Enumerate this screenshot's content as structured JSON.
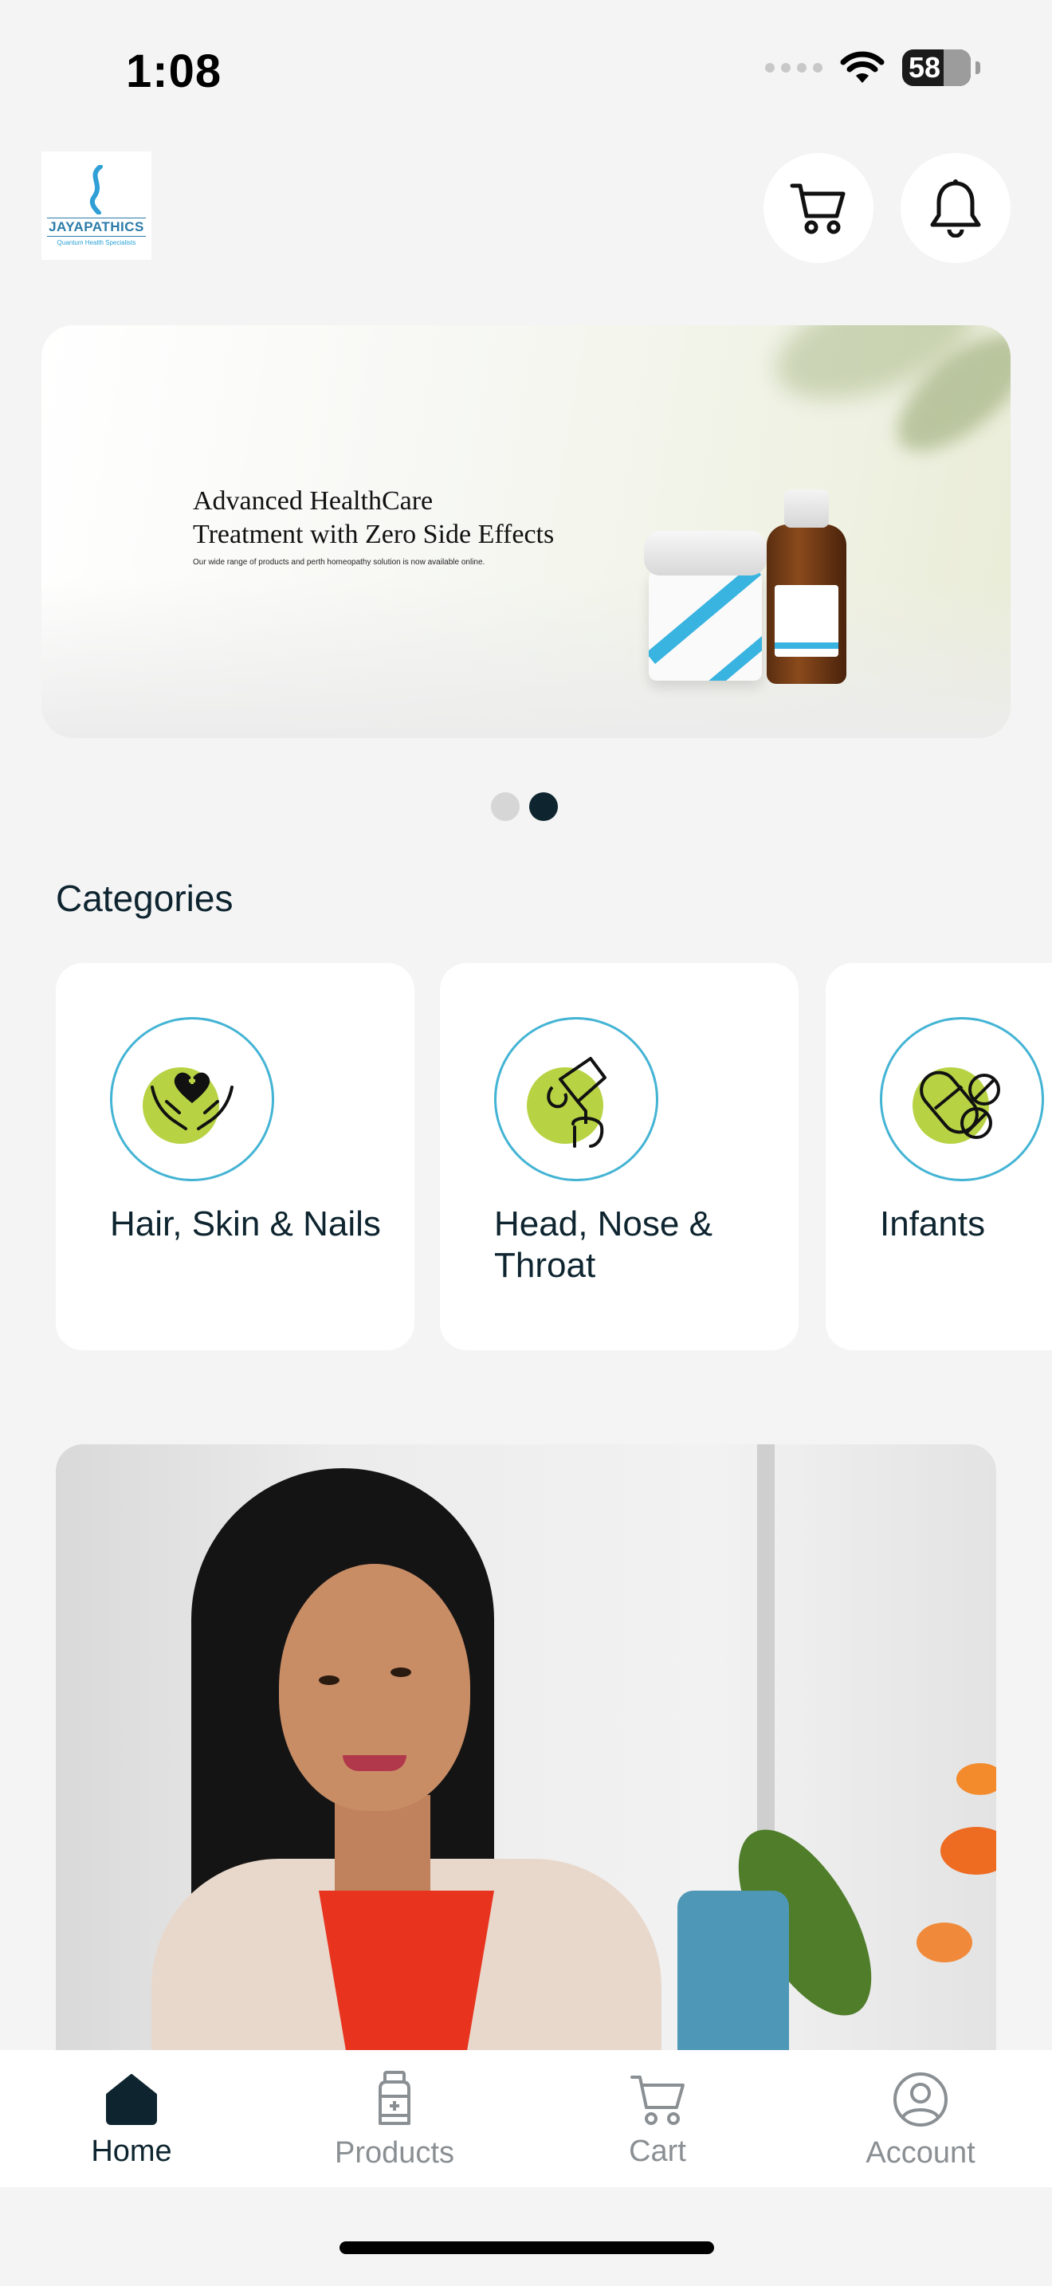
{
  "status_bar": {
    "time": "1:08",
    "battery": "58"
  },
  "header": {
    "logo_brand": "JAYAPATHICS",
    "logo_tagline": "Quantum Health Specialists"
  },
  "banner": {
    "headline_line1": "Advanced HealthCare",
    "headline_line2": "Treatment with Zero Side Effects",
    "subtext": "Our wide range of products and perth homeopathy solution is now available online.",
    "active_slide": 2,
    "slide_count": 2
  },
  "categories": {
    "title": "Categories",
    "items": [
      {
        "label": "Hair, Skin & Nails",
        "icon": "heart-hands-icon"
      },
      {
        "label": "Head, Nose & Throat",
        "icon": "nasal-spray-icon"
      },
      {
        "label": "Infants",
        "icon": "pills-icon"
      }
    ]
  },
  "tabs": [
    {
      "label": "Home",
      "icon": "home-icon",
      "active": true
    },
    {
      "label": "Products",
      "icon": "medicine-bottle-icon",
      "active": false
    },
    {
      "label": "Cart",
      "icon": "cart-icon",
      "active": false
    },
    {
      "label": "Account",
      "icon": "account-icon",
      "active": false
    }
  ],
  "colors": {
    "accent": "#0e2530",
    "teal": "#44b4d4",
    "lime": "#b7d344",
    "inactive": "#8a8f93"
  }
}
